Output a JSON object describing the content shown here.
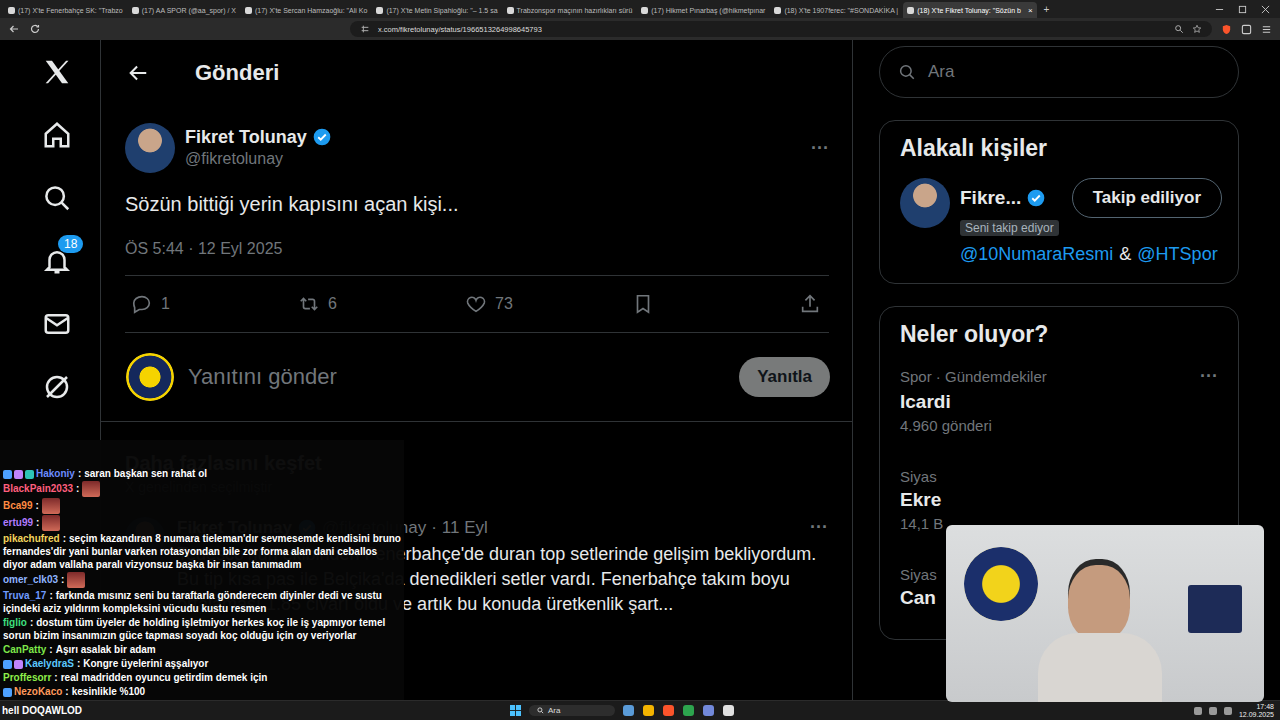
{
  "browser": {
    "tabs": [
      {
        "label": "(17) X'te Fenerbahçe SK: \"Trabzo",
        "selected": false
      },
      {
        "label": "(17) AA SPOR (@aa_spor) / X",
        "selected": false
      },
      {
        "label": "(17) X'te Sercan Hamzaoğlu: \"Ali Ko",
        "selected": false
      },
      {
        "label": "(17) X'te Metin Sipahioğlu: \"– 1.5 sa",
        "selected": false
      },
      {
        "label": "Trabzonspor maçının hazırlıkları sürü",
        "selected": false
      },
      {
        "label": "(17) Hikmet Pınarbaş (@hikmetpınar",
        "selected": false
      },
      {
        "label": "(18) X'te 1907ferec: \"#SONDAKİKA |",
        "selected": false
      },
      {
        "label": "(18) X'te Fikret Tolunay: \"Sözün b",
        "selected": true
      }
    ],
    "close": "×",
    "new_tab": "+",
    "url": "x.com/fikretolunay/status/1966513264998645793"
  },
  "nav": [
    {
      "kind": "logo"
    },
    {
      "kind": "home"
    },
    {
      "kind": "search"
    },
    {
      "kind": "notifications",
      "badge": "18"
    },
    {
      "kind": "messages"
    },
    {
      "kind": "grok"
    }
  ],
  "header": {
    "title": "Gönderi"
  },
  "post": {
    "author": "Fikret Tolunay",
    "handle": "@fikretolunay",
    "verified": true,
    "more": "···",
    "text": "Sözün bittiği yerin kapısını açan kişi...",
    "time": "ÖS 5:44 · 12 Eyl 2025",
    "actions": [
      {
        "kind": "reply",
        "count": "1"
      },
      {
        "kind": "repost",
        "count": "6"
      },
      {
        "kind": "like",
        "count": "73"
      },
      {
        "kind": "bookmark"
      },
      {
        "kind": "share"
      }
    ]
  },
  "reply_box": {
    "placeholder": "Yanıtını gönder",
    "button": "Yanıtla",
    "button_disabled": true
  },
  "discover": {
    "title": "Daha fazlasını keşfet",
    "subtitle": "X genelinden seçilmiştir",
    "posts": [
      {
        "author": "Fikret Tolunay",
        "verified": true,
        "handle": "@fikretolunay",
        "separator": "·",
        "date": "11 Eyl",
        "more": "···",
        "text": "Tedesco'nun ekibinden Fenerbahçe'de duran top setlerinde gelişim bekliyordum. Bu tip kısa pas ile Belçika'da denedikleri setler vardı. Fenerbahçe takım boyu ortalaması 1.85 civarı oldu ve artık bu konuda üretkenlik şart..."
      }
    ]
  },
  "sidebar": {
    "search_placeholder": "Ara",
    "related": {
      "title": "Alakalı kişiler",
      "people": [
        {
          "name": "Fikre...",
          "verified": true,
          "badge": "Seni takip ediyor",
          "button": "Takip ediliyor",
          "bio": [
            {
              "text": "@10NumaraResmi",
              "link": true
            },
            {
              "text": "&",
              "link": false
            },
            {
              "text": "@HTSpor",
              "link": true
            }
          ]
        }
      ]
    },
    "trends": {
      "title": "Neler oluyor?",
      "items": [
        {
          "category": "Spor · Gündemdekiler",
          "title": "Icardi",
          "count": "4.960 gönderi",
          "more": "···"
        },
        {
          "category": "Siyas",
          "title": "Ekre",
          "count": "14,1 B"
        },
        {
          "category": "Siyas",
          "title": "Can"
        }
      ]
    }
  },
  "chat": {
    "separator": ":",
    "messages": [
      {
        "user": "Hakoniy",
        "color": "#6c8cff",
        "badges": 3,
        "text": "saran başkan sen rahat ol",
        "emote": false
      },
      {
        "user": "BlackPain2033",
        "color": "#ff5f7e",
        "badges": 0,
        "text": "",
        "emote": true
      },
      {
        "user": "Bca99",
        "color": "#ff8c42",
        "badges": 0,
        "text": "",
        "emote": true
      },
      {
        "user": "ertu99",
        "color": "#b07cff",
        "badges": 0,
        "text": "",
        "emote": true
      },
      {
        "user": "pikachufred",
        "color": "#f2d45c",
        "badges": 0,
        "text": "seçim kazandıran 8 numara tieleman'dır sevmesemde kendisini bruno fernandes'dir yani bunlar varken rotasyondan bile zor forma alan dani ceballos diyor adam vallaha paralı vizyonsuz başka bir insan tanımadım",
        "emote": false
      },
      {
        "user": "omer_clk03",
        "color": "#8fb4ff",
        "badges": 0,
        "text": "",
        "emote": true
      },
      {
        "user": "Truva_17",
        "color": "#6f9bff",
        "badges": 0,
        "text": "farkında mısınız seni bu taraftarla gönderecem diyinler dedi ve sustu içindeki aziz yıldırım kompleksini vücudu kustu resmen",
        "emote": false
      },
      {
        "user": "figlio",
        "color": "#3fe07f",
        "badges": 0,
        "text": "dostum tüm üyeler de holding işletmiyor herkes koç ile iş yapmıyor temel sorun bizim insanımızın güce tapması soyadı koç olduğu için oy veriyorlar",
        "emote": false
      },
      {
        "user": "CanPatty",
        "color": "#7ee84a",
        "badges": 0,
        "text": "Aşırı asalak bir adam",
        "emote": false
      },
      {
        "user": "KaelydraS",
        "color": "#5cc8ff",
        "badges": 2,
        "text": "Kongre üyelerini aşşalıyor",
        "emote": false
      },
      {
        "user": "Proffesorr",
        "color": "#8ef04a",
        "badges": 0,
        "text": "real madridden oyuncu getirdim demek için",
        "emote": false
      },
      {
        "user": "NezoKaco",
        "color": "#ff9a5c",
        "badges": 1,
        "text": "kesinlikle %100",
        "emote": false
      }
    ]
  },
  "taskbar": {
    "ticker": "hell DOQAWLOD",
    "search": "Ara",
    "time": "17:48",
    "date": "12.09.2025"
  }
}
